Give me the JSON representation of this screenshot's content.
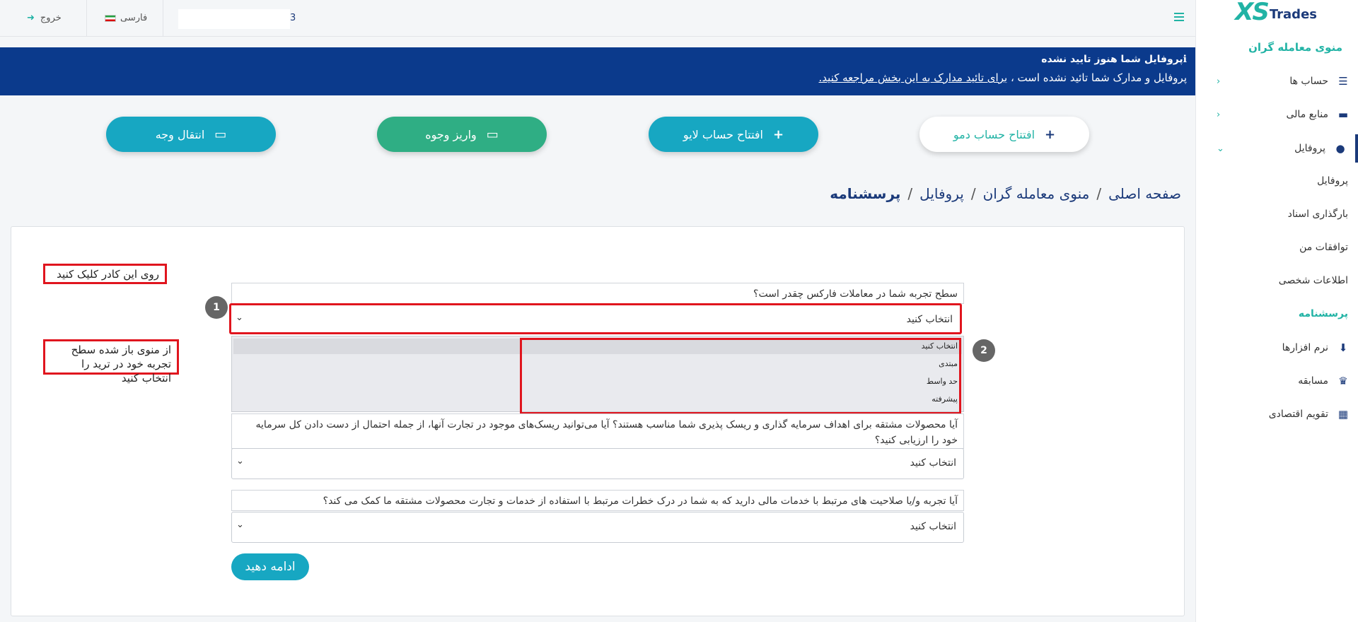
{
  "brand": {
    "logo_xs": "XS",
    "logo_trades": "Trades"
  },
  "topbar": {
    "logout_label": "خروج",
    "language_label": "فارسی",
    "user_id_fragment": "3"
  },
  "sidebar": {
    "section_title": "منوی معامله گران",
    "items": [
      {
        "label": "حساب ها",
        "icon": "list-icon"
      },
      {
        "label": "منابع مالی",
        "icon": "wallet-icon"
      },
      {
        "label": "پروفایل",
        "icon": "user-icon"
      }
    ],
    "profile_sub": [
      "پروفایل",
      "بارگذاری اسناد",
      "توافقات من",
      "اطلاعات شخصی",
      "پرسشنامه"
    ],
    "other_items": [
      {
        "label": "نرم افزارها",
        "icon": "download-icon"
      },
      {
        "label": "مسابقه",
        "icon": "trophy-icon"
      },
      {
        "label": "تقویم اقتصادی",
        "icon": "calendar-icon"
      }
    ]
  },
  "banner": {
    "title": "پروفایل شما هنوز تایید نشده",
    "text_prefix": "پروفایل و مدارک شما تائید نشده است ،",
    "link_text": "برای تائید مدارک به این بخش مراجعه کنید.",
    "color": "#0b3a8c"
  },
  "actions": {
    "demo": "افتتاح حساب دمو",
    "live": "افتتاح حساب لایو",
    "deposit": "واریز وجوه",
    "transfer": "انتقال وجه"
  },
  "breadcrumb": {
    "home": "صفحه اصلی",
    "traders_menu": "منوی معامله گران",
    "profile": "پروفایل",
    "current": "پرسشنامه",
    "separator": "/"
  },
  "annotations": {
    "step1_text": "روی این کادر کلیک کنید",
    "step2_text": "از منوی باز شده سطح تجربه خود در ترید را انتخاب کنید",
    "badge1": "1",
    "badge2": "2"
  },
  "questionnaire": {
    "q1": "سطح تجربه شما در معاملات فارکس چقدر است؟",
    "q2": "آیا محصولات مشتقه برای اهداف سرمایه گذاری و ریسک پذیری شما مناسب هستند؟ آیا می‌توانید ریسک‌های موجود در تجارت آنها، از جمله احتمال از دست دادن کل سرمایه خود را ارزیابی کنید؟",
    "q3": "آیا تجربه و/یا صلاحیت های مرتبط با خدمات مالی دارید که به شما در درک خطرات مرتبط با استفاده از خدمات و تجارت محصولات مشتقه ما کمک می کند؟",
    "select_placeholder": "انتخاب کنید",
    "dropdown_options": [
      "انتخاب کنید",
      "مبتدی",
      "حد واسط",
      "پیشرفته"
    ],
    "continue_label": "ادامه دهید"
  },
  "colors": {
    "accent": "#21b3a5",
    "brand_dark": "#1b3a7a",
    "button_teal": "#17a7c2",
    "button_green": "#2fae84",
    "annotation_red": "#e0151e"
  }
}
